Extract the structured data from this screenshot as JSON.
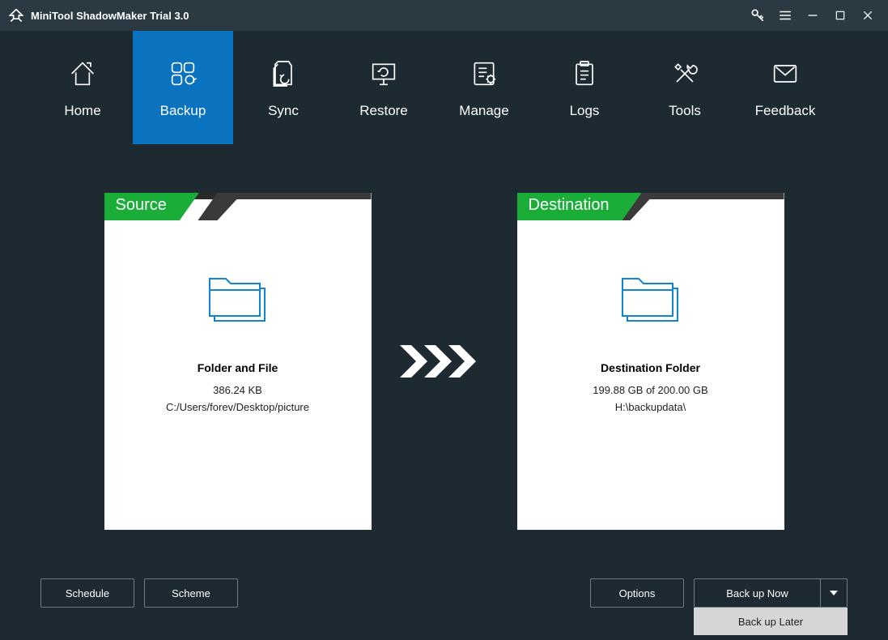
{
  "titlebar": {
    "title": "MiniTool ShadowMaker Trial 3.0"
  },
  "nav": {
    "items": [
      {
        "label": "Home"
      },
      {
        "label": "Backup"
      },
      {
        "label": "Sync"
      },
      {
        "label": "Restore"
      },
      {
        "label": "Manage"
      },
      {
        "label": "Logs"
      },
      {
        "label": "Tools"
      },
      {
        "label": "Feedback"
      }
    ]
  },
  "source": {
    "tab": "Source",
    "title": "Folder and File",
    "size": "386.24 KB",
    "path": "C:/Users/forev/Desktop/picture"
  },
  "destination": {
    "tab": "Destination",
    "title": "Destination Folder",
    "size": "199.88 GB of 200.00 GB",
    "path": "H:\\backupdata\\"
  },
  "footer": {
    "schedule": "Schedule",
    "scheme": "Scheme",
    "options": "Options",
    "backup_now": "Back up Now",
    "backup_later": "Back up Later"
  }
}
